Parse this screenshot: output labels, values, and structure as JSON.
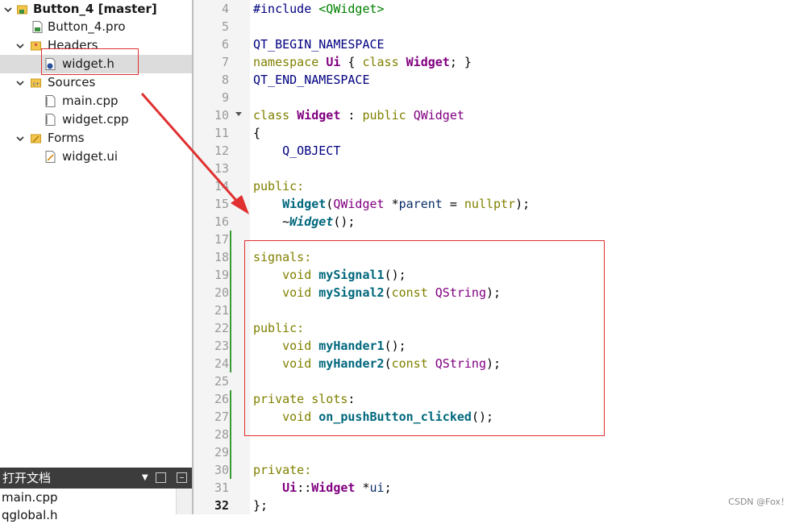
{
  "project_tree": {
    "project_name": "Button_4 [master]",
    "items": [
      {
        "label": "Button_4.pro",
        "icon": "pro-file-icon"
      },
      {
        "label": "Headers",
        "icon": "headers-folder-icon"
      },
      {
        "label": "widget.h",
        "icon": "header-file-icon"
      },
      {
        "label": "Sources",
        "icon": "sources-folder-icon"
      },
      {
        "label": "main.cpp",
        "icon": "cpp-file-icon"
      },
      {
        "label": "widget.cpp",
        "icon": "cpp-file-icon"
      },
      {
        "label": "Forms",
        "icon": "forms-folder-icon"
      },
      {
        "label": "widget.ui",
        "icon": "ui-file-icon"
      }
    ]
  },
  "open_documents": {
    "title": "打开文档",
    "items": [
      "main.cpp",
      "qglobal.h"
    ]
  },
  "editor": {
    "line_numbers": [
      "4",
      "5",
      "6",
      "7",
      "8",
      "9",
      "10",
      "11",
      "12",
      "13",
      "14",
      "15",
      "16",
      "17",
      "18",
      "19",
      "20",
      "21",
      "22",
      "23",
      "24",
      "25",
      "26",
      "27",
      "28",
      "29",
      "30",
      "31",
      "32"
    ],
    "current_line": "32",
    "code": {
      "l4_a": "#include ",
      "l4_b": "<QWidget>",
      "l6": "QT_BEGIN_NAMESPACE",
      "l7_a": "namespace ",
      "l7_b": "Ui",
      "l7_c": " { ",
      "l7_d": "class ",
      "l7_e": "Widget",
      "l7_f": "; }",
      "l8": "QT_END_NAMESPACE",
      "l10_a": "class ",
      "l10_b": "Widget",
      "l10_c": " : ",
      "l10_d": "public ",
      "l10_e": "QWidget",
      "l11": "{",
      "l12": "    Q_OBJECT",
      "l14": "public:",
      "l15_a": "    ",
      "l15_b": "Widget",
      "l15_c": "(",
      "l15_d": "QWidget",
      "l15_e": " *",
      "l15_f": "parent",
      "l15_g": " = ",
      "l15_h": "nullptr",
      "l15_i": ");",
      "l16_a": "    ~",
      "l16_b": "Widget",
      "l16_c": "();",
      "l18": "signals:",
      "l19_a": "    ",
      "l19_b": "void ",
      "l19_c": "mySignal1",
      "l19_d": "();",
      "l20_a": "    ",
      "l20_b": "void ",
      "l20_c": "mySignal2",
      "l20_d": "(",
      "l20_e": "const ",
      "l20_f": "QString",
      "l20_g": ");",
      "l22": "public:",
      "l23_a": "    ",
      "l23_b": "void ",
      "l23_c": "myHander1",
      "l23_d": "();",
      "l24_a": "    ",
      "l24_b": "void ",
      "l24_c": "myHander2",
      "l24_d": "(",
      "l24_e": "const ",
      "l24_f": "QString",
      "l24_g": ");",
      "l26_a": "private ",
      "l26_b": "slots",
      "l26_c": ":",
      "l27_a": "    ",
      "l27_b": "void ",
      "l27_c": "on_pushButton_clicked",
      "l27_d": "();",
      "l30": "private:",
      "l31_a": "    ",
      "l31_b": "Ui",
      "l31_c": "::",
      "l31_d": "Widget",
      "l31_e": " *",
      "l31_f": "ui",
      "l31_g": ";",
      "l32": "};"
    }
  },
  "annotation_color": "#e03030",
  "watermark": "CSDN @Fox！"
}
